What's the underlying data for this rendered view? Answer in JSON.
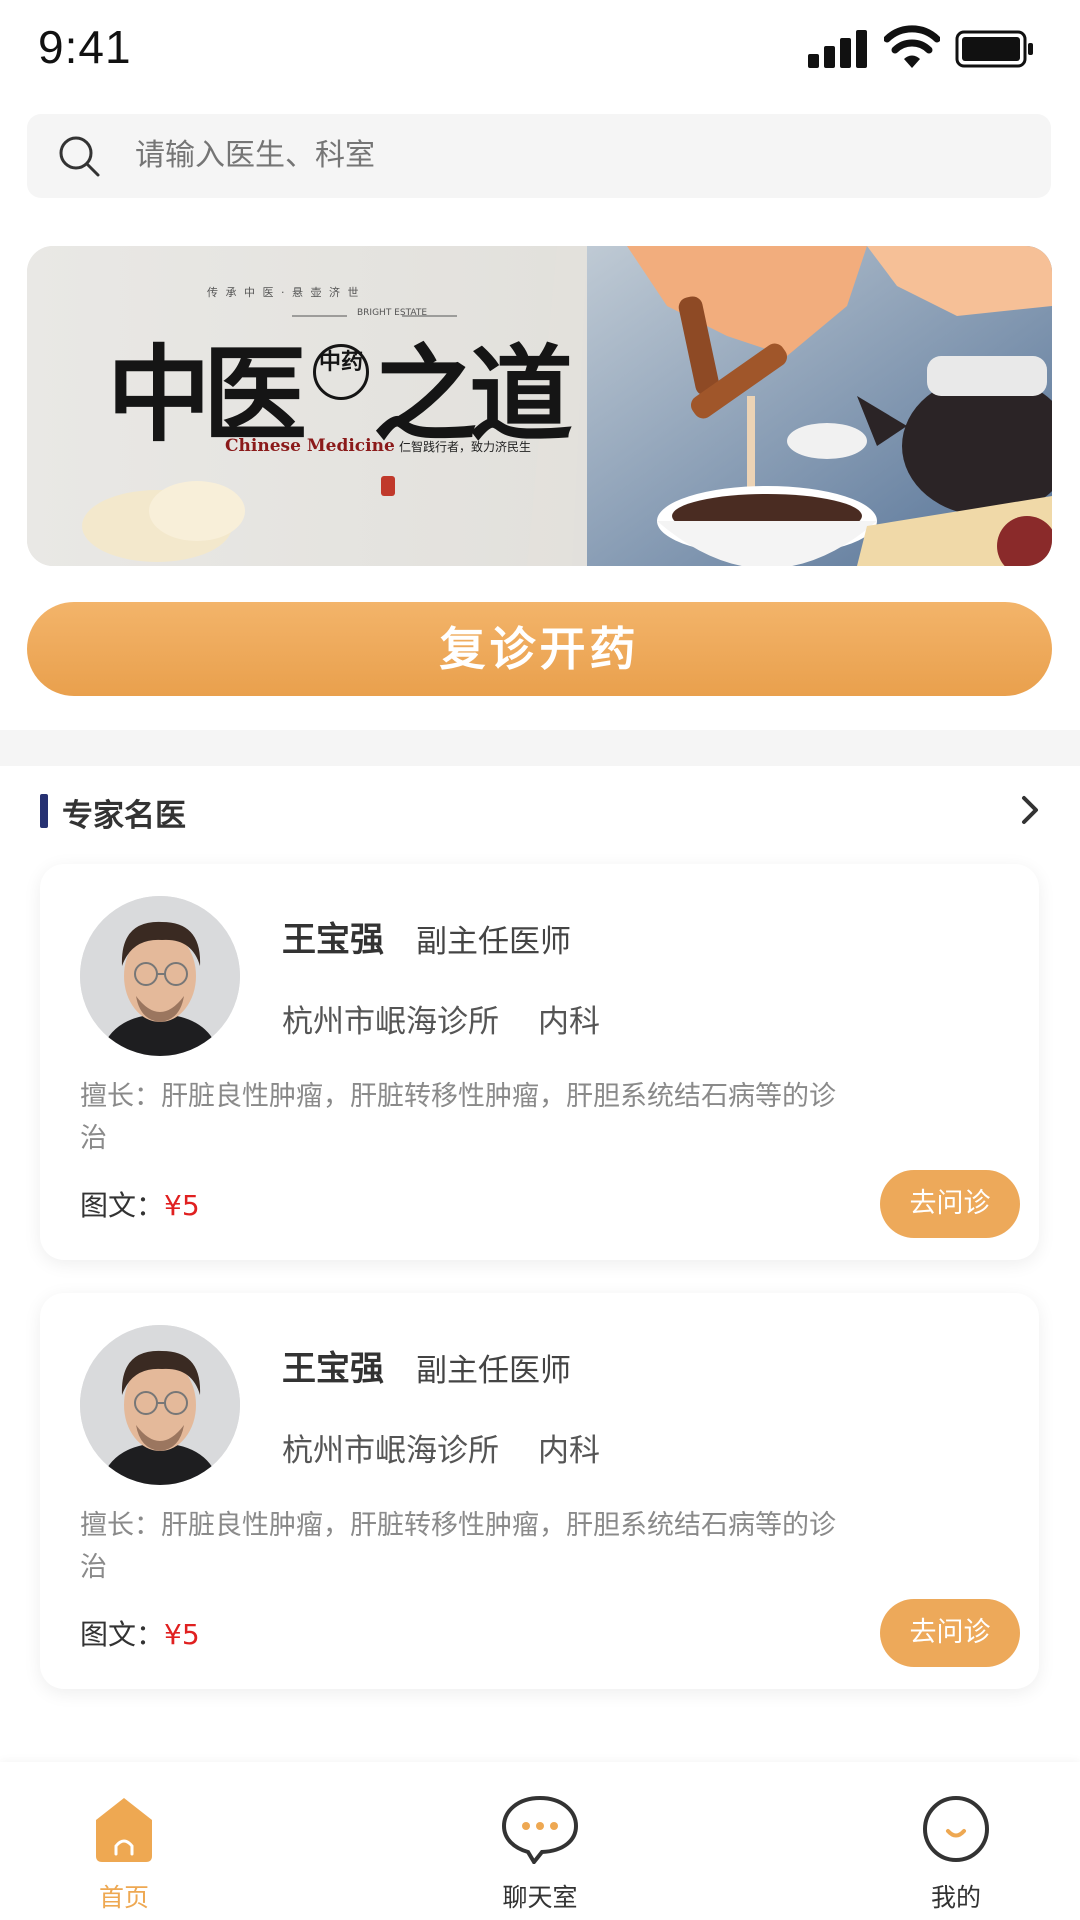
{
  "status_bar": {
    "time": "9:41"
  },
  "search": {
    "placeholder": "请输入医生、科室"
  },
  "banner": {
    "title_left": "中医",
    "title_seal": "中药",
    "title_right": "之道",
    "subtitle_en": "Chinese Medicine",
    "subtitle_cn": "仁智践行者，致力济民生",
    "top_line": "传 承 中 医  ·  悬 壶 济 世",
    "brand": "BRIGHT ESTATE"
  },
  "main_action": {
    "label": "复诊开药"
  },
  "section": {
    "title": "专家名医"
  },
  "doctors": [
    {
      "name": "王宝强",
      "title": "副主任医师",
      "clinic": "杭州市岷海诊所",
      "dept": "内科",
      "desc": "擅长：肝脏良性肿瘤，肝脏转移性肿瘤，肝胆系统结石病等的诊治",
      "price_label": "图文：",
      "price": "¥5",
      "button": "去问诊"
    },
    {
      "name": "王宝强",
      "title": "副主任医师",
      "clinic": "杭州市岷海诊所",
      "dept": "内科",
      "desc": "擅长：肝脏良性肿瘤，肝脏转移性肿瘤，肝胆系统结石病等的诊治",
      "price_label": "图文：",
      "price": "¥5",
      "button": "去问诊"
    }
  ],
  "tabs": [
    {
      "label": "首页",
      "icon": "home-icon",
      "active": true
    },
    {
      "label": "聊天室",
      "icon": "chat-icon",
      "active": false
    },
    {
      "label": "我的",
      "icon": "profile-icon",
      "active": false
    }
  ],
  "colors": {
    "accent": "#EEA852",
    "price": "#E02020",
    "section_bar": "#263172"
  }
}
